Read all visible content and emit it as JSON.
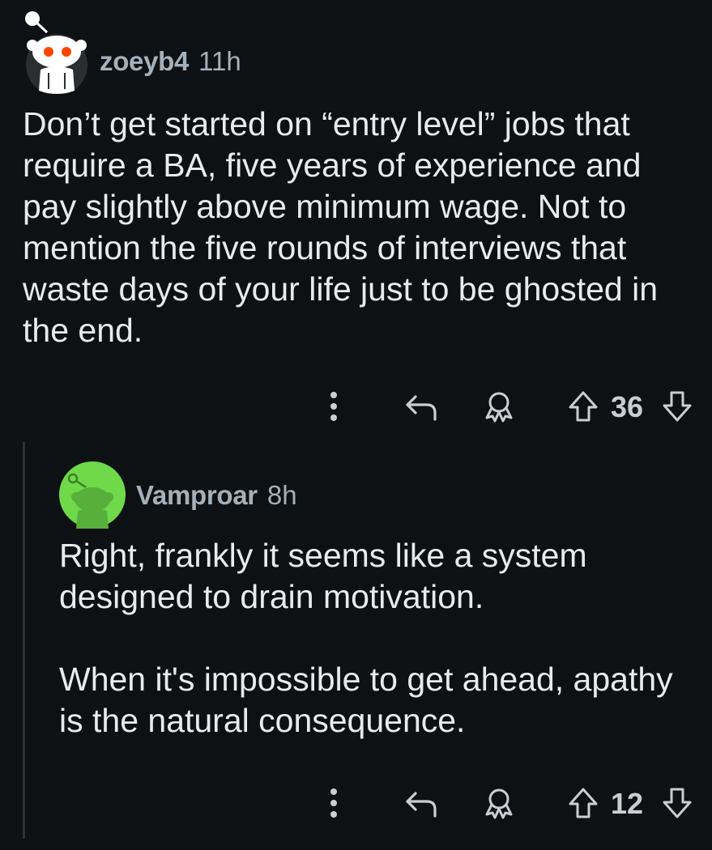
{
  "comments": [
    {
      "username": "zoeyb4",
      "time": "11h",
      "body": "Don’t get started on “entry level” jobs that require a BA, five years of experience and pay slightly above minimum wage. Not to mention the five rounds of interviews that waste days of your life just to be ghosted in the end.",
      "score": "36",
      "avatar_icon": "snoo-avatar-icon",
      "avatar_color": "#2a2e31"
    },
    {
      "username": "Vamproar",
      "time": "8h",
      "body_paragraphs": [
        "Right, frankly it seems like a system designed to drain motivation.",
        "When it's impossible to get ahead, apathy is the natural consequence."
      ],
      "score": "12",
      "avatar_icon": "snoo-avatar-icon",
      "avatar_color": "#6fd94a"
    }
  ],
  "actions": {
    "more_icon": "more-vertical-icon",
    "reply_icon": "reply-icon",
    "award_icon": "award-icon",
    "upvote_icon": "upvote-arrow-icon",
    "downvote_icon": "downvote-arrow-icon"
  },
  "colors": {
    "background": "#0e1113",
    "text": "#e8eaec",
    "meta": "#a3b1bc",
    "icon": "#c8ced3",
    "thread_line": "#2b3236"
  }
}
